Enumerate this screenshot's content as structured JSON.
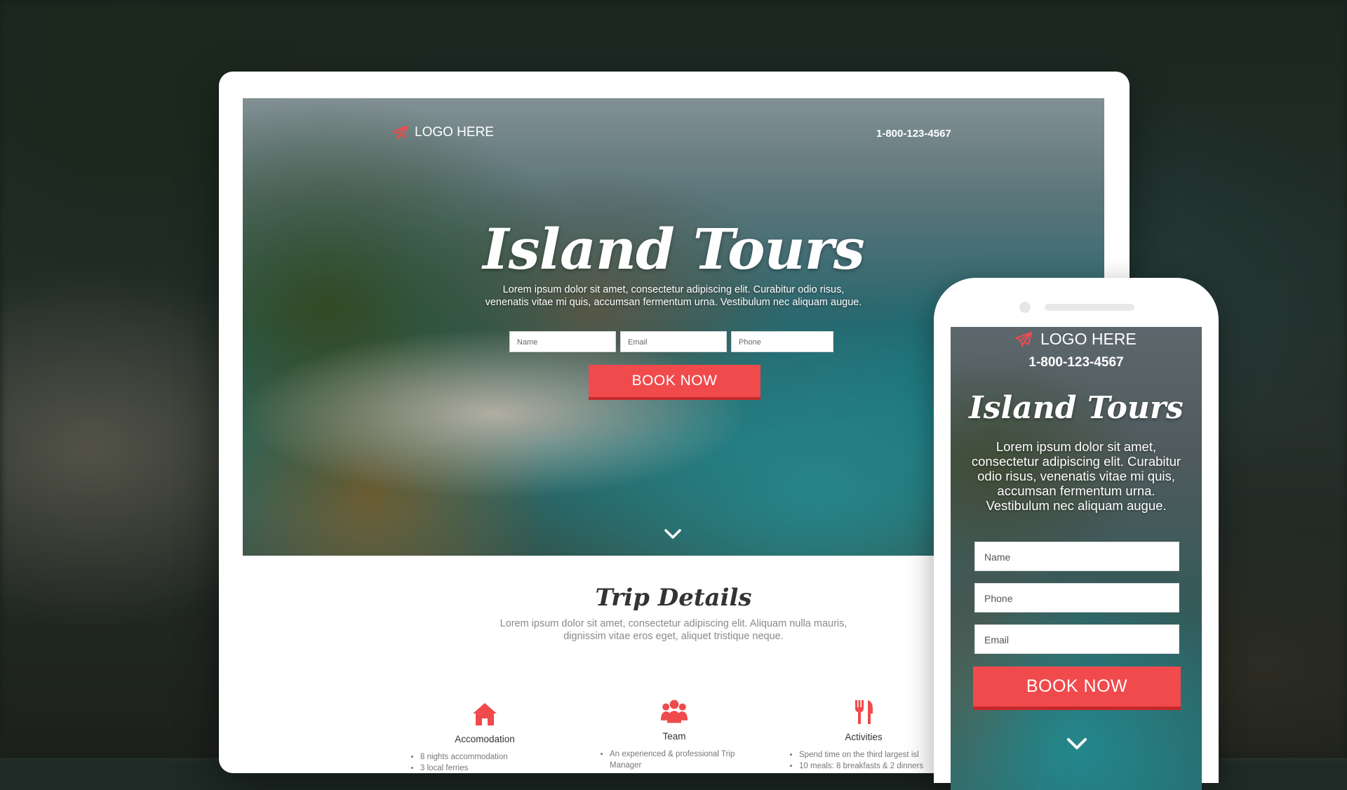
{
  "desktop": {
    "logo_text": "LOGO HERE",
    "phone": "1-800-123-4567",
    "title": "Island Tours",
    "subtitle_lines": [
      "Lorem ipsum dolor sit amet, consectetur adipiscing elit. Curabitur odio risus,",
      "venenatis vitae mi quis, accumsan fermentum urna. Vestibulum nec aliquam augue."
    ],
    "form": {
      "name_placeholder": "Name",
      "email_placeholder": "Email",
      "phone_placeholder": "Phone",
      "button_label": "BOOK NOW"
    },
    "trip": {
      "title": "Trip Details",
      "subtitle_lines": [
        "Lorem ipsum dolor sit amet, consectetur adipiscing elit. Aliquam nulla mauris,",
        "dignissim vitae eros eget, aliquet tristique neque."
      ],
      "features": [
        {
          "icon": "home-icon",
          "title": "Accomodation",
          "items": [
            "8 nights accommodation",
            "3 local ferries"
          ]
        },
        {
          "icon": "team-icon",
          "title": "Team",
          "items": [
            "An experienced & professional Trip Manager"
          ]
        },
        {
          "icon": "utensils-icon",
          "title": "Activities",
          "items": [
            "Spend time on the third largest isl",
            "10 meals: 8 breakfasts & 2 dinners"
          ]
        }
      ]
    }
  },
  "mobile": {
    "logo_text": "LOGO HERE",
    "phone": "1-800-123-4567",
    "title": "Island Tours",
    "subtitle_lines": [
      "Lorem ipsum dolor sit amet,",
      "consectetur adipiscing elit. Curabitur",
      "odio risus, venenatis vitae mi quis,",
      "accumsan fermentum urna.",
      "Vestibulum nec aliquam augue."
    ],
    "form": {
      "name_placeholder": "Name",
      "phone_placeholder": "Phone",
      "email_placeholder": "Email",
      "button_label": "BOOK NOW"
    }
  },
  "colors": {
    "accent": "#f04a4d",
    "accent_dark": "#c7282c"
  }
}
